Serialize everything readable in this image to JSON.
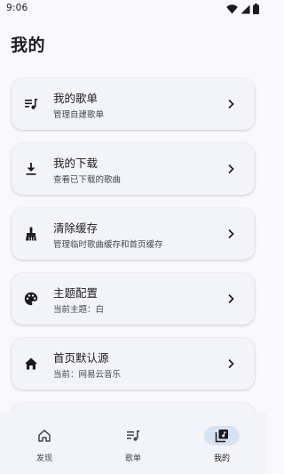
{
  "status_bar": {
    "time": "9:06",
    "icons": [
      "wifi-icon",
      "signal-icon",
      "battery-icon"
    ]
  },
  "page": {
    "title": "我的"
  },
  "settings_items": [
    {
      "icon": "playlist-icon",
      "title": "我的歌单",
      "subtitle": "管理自建歌单"
    },
    {
      "icon": "download-icon",
      "title": "我的下载",
      "subtitle": "查看已下载的歌曲"
    },
    {
      "icon": "broom-icon",
      "title": "清除缓存",
      "subtitle": "管理临时歌曲缓存和首页缓存"
    },
    {
      "icon": "palette-icon",
      "title": "主题配置",
      "subtitle": "当前主题：白"
    },
    {
      "icon": "home-icon",
      "title": "首页默认源",
      "subtitle": "当前：网易云音乐"
    }
  ],
  "bottom_nav": {
    "items": [
      {
        "icon": "home-outline-icon",
        "label": "发现",
        "active": false
      },
      {
        "icon": "playlist-icon",
        "label": "歌单",
        "active": false
      },
      {
        "icon": "library-icon",
        "label": "我的",
        "active": true
      }
    ]
  },
  "colors": {
    "background": "#f9f9fb",
    "card": "#f3f4f9",
    "text_primary": "#1c1b1f",
    "text_secondary": "#44474e",
    "nav_active_indicator": "#d6e3f3"
  }
}
